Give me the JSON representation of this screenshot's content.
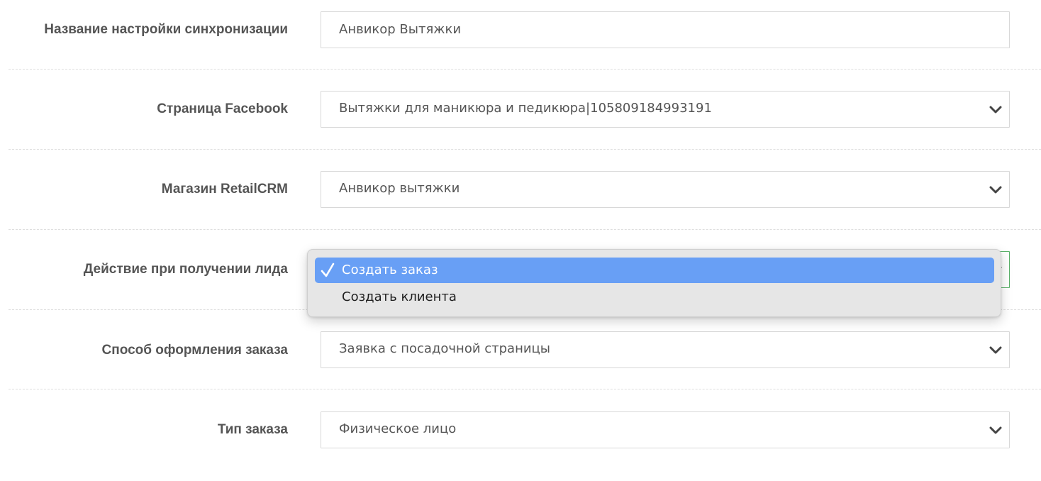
{
  "form": {
    "sync_name": {
      "label": "Название настройки синхронизации",
      "value": "Анвикор Вытяжки"
    },
    "facebook_page": {
      "label": "Страница Facebook",
      "value": "Вытяжки для маникюра и педикюра|105809184993191"
    },
    "retailcrm_store": {
      "label": "Магазин RetailCRM",
      "value": "Анвикор вытяжки"
    },
    "lead_action": {
      "label": "Действие при получении лида",
      "options": [
        "Создать заказ",
        "Создать клиента"
      ],
      "selected": "Создать заказ"
    },
    "order_method": {
      "label": "Способ оформления заказа",
      "value": "Заявка с посадочной страницы"
    },
    "order_type": {
      "label": "Тип заказа",
      "value": "Физическое лицо"
    }
  },
  "colors": {
    "selected_option_bg": "#689ff5",
    "focus_border": "#5bb16a",
    "label_text": "#555555"
  },
  "icons": {
    "select_arrow": "chevron-down-icon",
    "selected_mark": "checkmark-icon"
  }
}
